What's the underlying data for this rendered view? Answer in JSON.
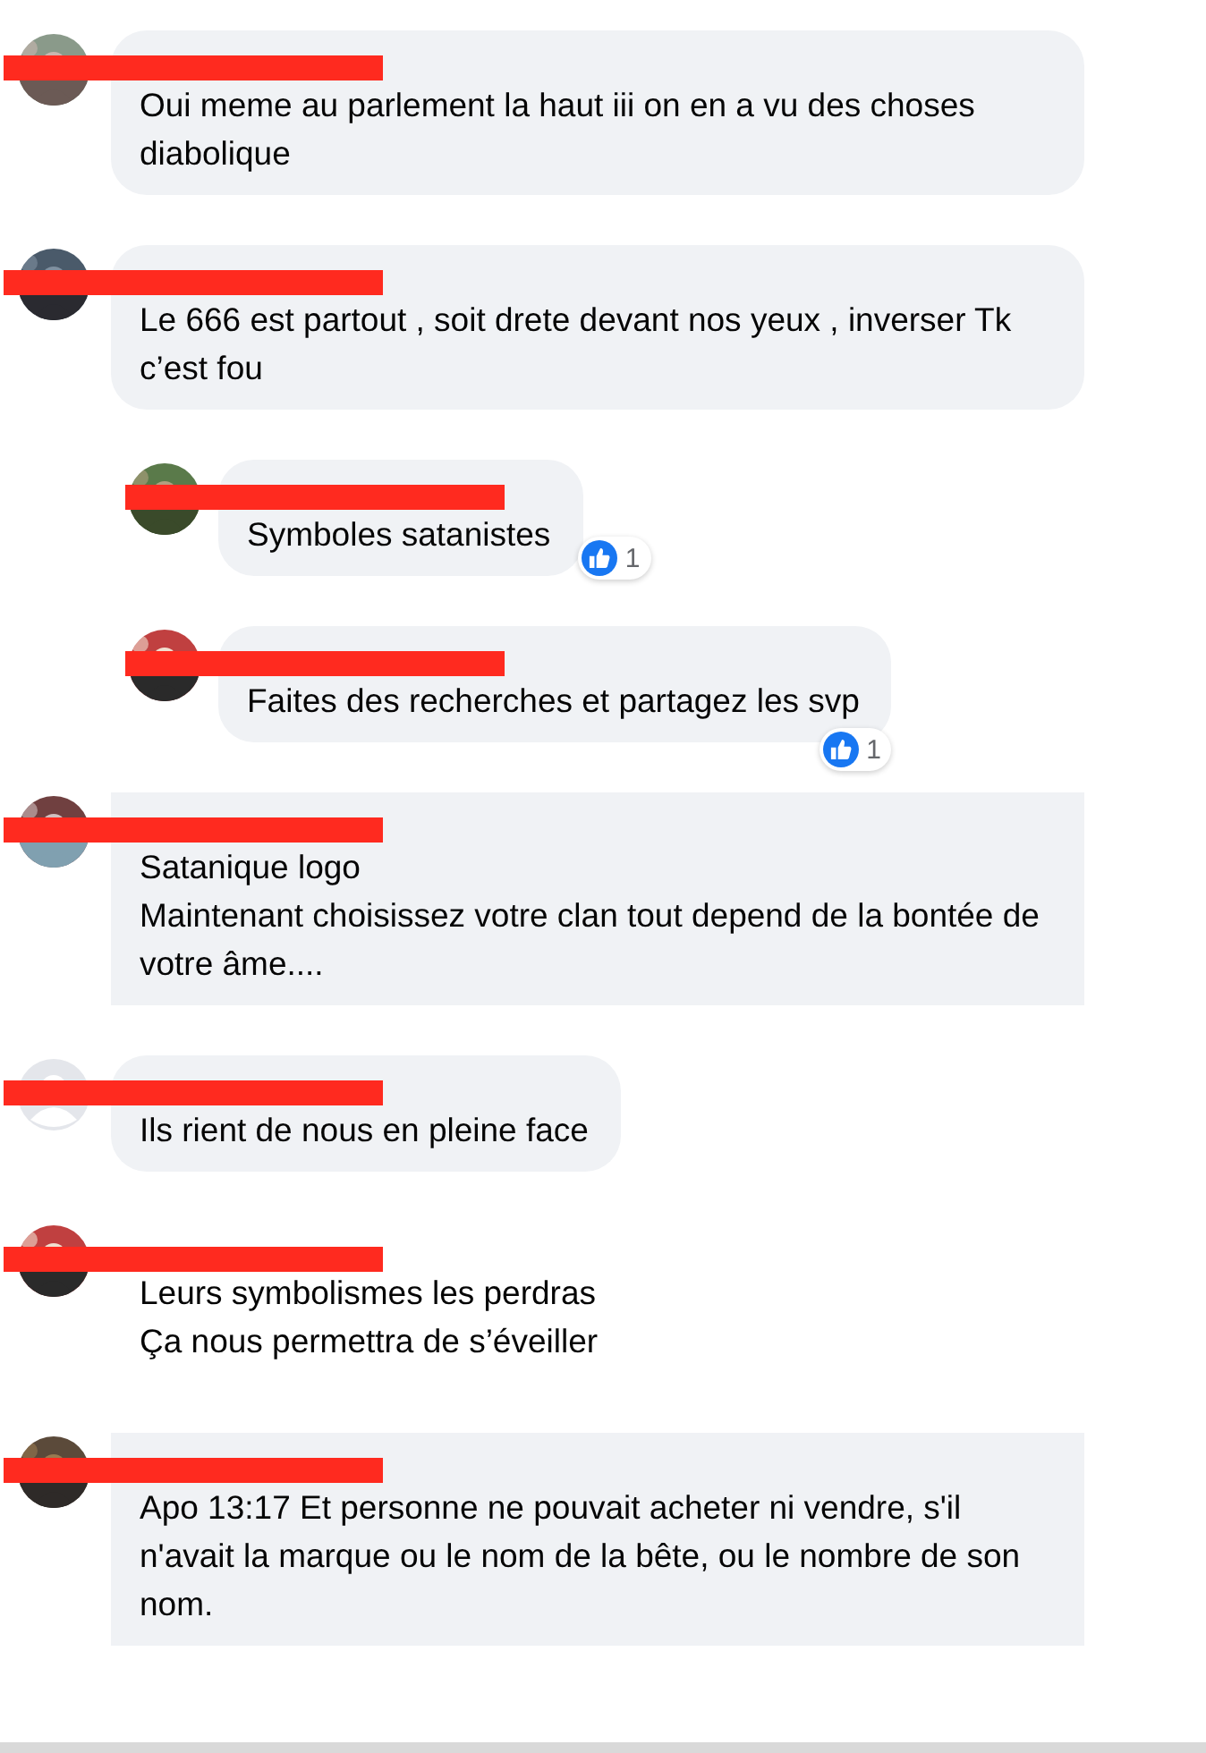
{
  "comments": [
    {
      "kind": "rounded",
      "text": "Oui meme au parlement la haut iii on en a vu des choses diabolique"
    },
    {
      "kind": "rounded",
      "text": "Le 666 est partout , soit drete devant nos yeux , inverser Tk c’est fou",
      "children": [
        {
          "kind": "rounded",
          "text": "Symboles satanistes",
          "reaction": {
            "count": "1",
            "kind": "side"
          }
        },
        {
          "kind": "rounded",
          "text": "Faites des recherches et partagez les svp",
          "reaction": {
            "count": "1",
            "kind": "bottom"
          }
        }
      ]
    },
    {
      "kind": "square",
      "text": "Satanique logo\nMaintenant choisissez votre clan tout depend de la bontée de votre âme...."
    },
    {
      "avatar": {
        "kind": "silhouette"
      },
      "kind": "rounded",
      "text": "Ils rient de nous en pleine face"
    },
    {
      "kind": "none",
      "text": "Leurs symbolismes les perdras\nÇa nous permettra de s’éveiller"
    },
    {
      "kind": "square",
      "text": "Apo 13:17 Et personne ne pouvait acheter ni vendre, s'il n'avait la marque ou le nom de la bête, ou le nombre de son nom."
    }
  ]
}
